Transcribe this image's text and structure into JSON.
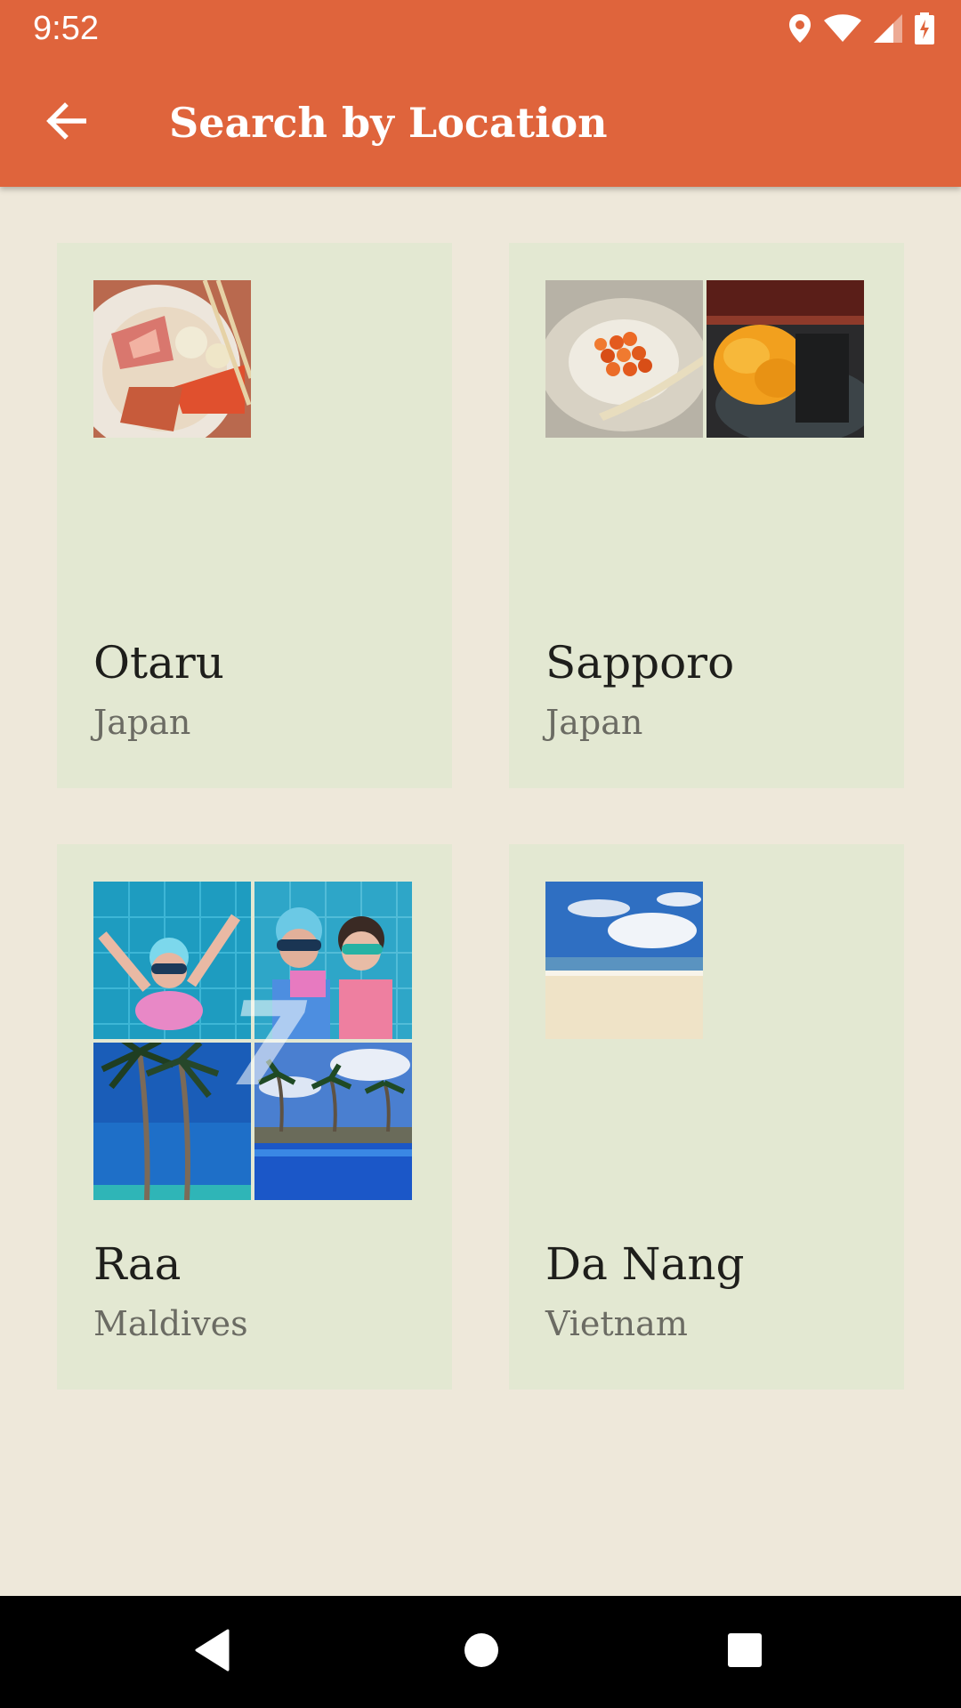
{
  "status_bar": {
    "time": "9:52",
    "icons": [
      "location-icon",
      "wifi-icon",
      "signal-icon",
      "battery-charging-icon"
    ]
  },
  "app_bar": {
    "title": "Search by Location",
    "back_icon": "arrow-back-icon",
    "color": "#DF643C"
  },
  "locations": [
    {
      "city": "Otaru",
      "country": "Japan",
      "photos": [
        "seafood-bowl-photo"
      ]
    },
    {
      "city": "Sapporo",
      "country": "Japan",
      "photos": [
        "salmon-roe-bowl-photo",
        "sea-urchin-sushi-photo"
      ]
    },
    {
      "city": "Raa",
      "country": "Maldives",
      "overlay_count": "7",
      "photos": [
        "underwater-swimmer-photo",
        "underwater-kids-photo",
        "palm-trees-photo",
        "resort-pool-photo"
      ]
    },
    {
      "city": "Da Nang",
      "country": "Vietnam",
      "photos": [
        "beach-photo"
      ]
    }
  ],
  "nav_bar": {
    "buttons": [
      "back-triangle-icon",
      "home-circle-icon",
      "recents-square-icon"
    ]
  },
  "colors": {
    "background": "#EEE8DA",
    "card": "#E3E8D2",
    "city_text": "#1E1E1B",
    "country_text": "#6B6B63"
  }
}
